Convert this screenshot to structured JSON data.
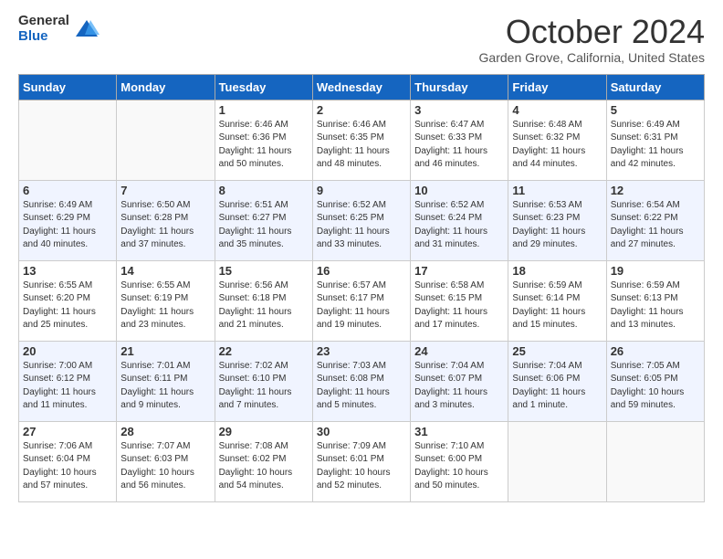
{
  "header": {
    "logo_general": "General",
    "logo_blue": "Blue",
    "month_title": "October 2024",
    "subtitle": "Garden Grove, California, United States"
  },
  "days_of_week": [
    "Sunday",
    "Monday",
    "Tuesday",
    "Wednesday",
    "Thursday",
    "Friday",
    "Saturday"
  ],
  "weeks": [
    [
      {
        "day": "",
        "info": ""
      },
      {
        "day": "",
        "info": ""
      },
      {
        "day": "1",
        "info": "Sunrise: 6:46 AM\nSunset: 6:36 PM\nDaylight: 11 hours and 50 minutes."
      },
      {
        "day": "2",
        "info": "Sunrise: 6:46 AM\nSunset: 6:35 PM\nDaylight: 11 hours and 48 minutes."
      },
      {
        "day": "3",
        "info": "Sunrise: 6:47 AM\nSunset: 6:33 PM\nDaylight: 11 hours and 46 minutes."
      },
      {
        "day": "4",
        "info": "Sunrise: 6:48 AM\nSunset: 6:32 PM\nDaylight: 11 hours and 44 minutes."
      },
      {
        "day": "5",
        "info": "Sunrise: 6:49 AM\nSunset: 6:31 PM\nDaylight: 11 hours and 42 minutes."
      }
    ],
    [
      {
        "day": "6",
        "info": "Sunrise: 6:49 AM\nSunset: 6:29 PM\nDaylight: 11 hours and 40 minutes."
      },
      {
        "day": "7",
        "info": "Sunrise: 6:50 AM\nSunset: 6:28 PM\nDaylight: 11 hours and 37 minutes."
      },
      {
        "day": "8",
        "info": "Sunrise: 6:51 AM\nSunset: 6:27 PM\nDaylight: 11 hours and 35 minutes."
      },
      {
        "day": "9",
        "info": "Sunrise: 6:52 AM\nSunset: 6:25 PM\nDaylight: 11 hours and 33 minutes."
      },
      {
        "day": "10",
        "info": "Sunrise: 6:52 AM\nSunset: 6:24 PM\nDaylight: 11 hours and 31 minutes."
      },
      {
        "day": "11",
        "info": "Sunrise: 6:53 AM\nSunset: 6:23 PM\nDaylight: 11 hours and 29 minutes."
      },
      {
        "day": "12",
        "info": "Sunrise: 6:54 AM\nSunset: 6:22 PM\nDaylight: 11 hours and 27 minutes."
      }
    ],
    [
      {
        "day": "13",
        "info": "Sunrise: 6:55 AM\nSunset: 6:20 PM\nDaylight: 11 hours and 25 minutes."
      },
      {
        "day": "14",
        "info": "Sunrise: 6:55 AM\nSunset: 6:19 PM\nDaylight: 11 hours and 23 minutes."
      },
      {
        "day": "15",
        "info": "Sunrise: 6:56 AM\nSunset: 6:18 PM\nDaylight: 11 hours and 21 minutes."
      },
      {
        "day": "16",
        "info": "Sunrise: 6:57 AM\nSunset: 6:17 PM\nDaylight: 11 hours and 19 minutes."
      },
      {
        "day": "17",
        "info": "Sunrise: 6:58 AM\nSunset: 6:15 PM\nDaylight: 11 hours and 17 minutes."
      },
      {
        "day": "18",
        "info": "Sunrise: 6:59 AM\nSunset: 6:14 PM\nDaylight: 11 hours and 15 minutes."
      },
      {
        "day": "19",
        "info": "Sunrise: 6:59 AM\nSunset: 6:13 PM\nDaylight: 11 hours and 13 minutes."
      }
    ],
    [
      {
        "day": "20",
        "info": "Sunrise: 7:00 AM\nSunset: 6:12 PM\nDaylight: 11 hours and 11 minutes."
      },
      {
        "day": "21",
        "info": "Sunrise: 7:01 AM\nSunset: 6:11 PM\nDaylight: 11 hours and 9 minutes."
      },
      {
        "day": "22",
        "info": "Sunrise: 7:02 AM\nSunset: 6:10 PM\nDaylight: 11 hours and 7 minutes."
      },
      {
        "day": "23",
        "info": "Sunrise: 7:03 AM\nSunset: 6:08 PM\nDaylight: 11 hours and 5 minutes."
      },
      {
        "day": "24",
        "info": "Sunrise: 7:04 AM\nSunset: 6:07 PM\nDaylight: 11 hours and 3 minutes."
      },
      {
        "day": "25",
        "info": "Sunrise: 7:04 AM\nSunset: 6:06 PM\nDaylight: 11 hours and 1 minute."
      },
      {
        "day": "26",
        "info": "Sunrise: 7:05 AM\nSunset: 6:05 PM\nDaylight: 10 hours and 59 minutes."
      }
    ],
    [
      {
        "day": "27",
        "info": "Sunrise: 7:06 AM\nSunset: 6:04 PM\nDaylight: 10 hours and 57 minutes."
      },
      {
        "day": "28",
        "info": "Sunrise: 7:07 AM\nSunset: 6:03 PM\nDaylight: 10 hours and 56 minutes."
      },
      {
        "day": "29",
        "info": "Sunrise: 7:08 AM\nSunset: 6:02 PM\nDaylight: 10 hours and 54 minutes."
      },
      {
        "day": "30",
        "info": "Sunrise: 7:09 AM\nSunset: 6:01 PM\nDaylight: 10 hours and 52 minutes."
      },
      {
        "day": "31",
        "info": "Sunrise: 7:10 AM\nSunset: 6:00 PM\nDaylight: 10 hours and 50 minutes."
      },
      {
        "day": "",
        "info": ""
      },
      {
        "day": "",
        "info": ""
      }
    ]
  ]
}
